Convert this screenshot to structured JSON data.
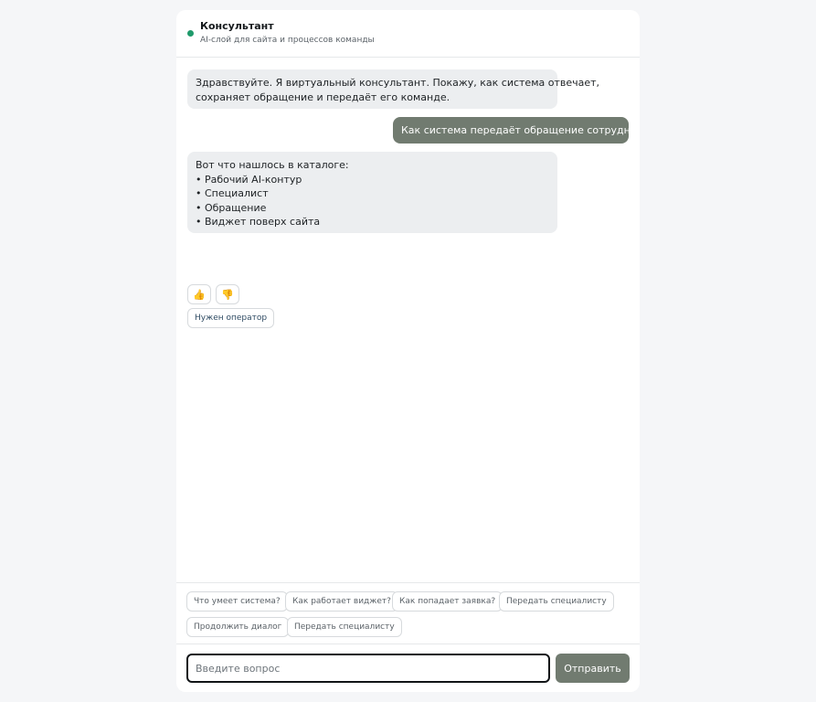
{
  "header": {
    "title": "Консультант",
    "subtitle": "AI-слой для сайта и процессов команды",
    "status_color": "#1f9a6b"
  },
  "messages": {
    "bot_greeting": {
      "lines": [
        "Здравствуйте. Я виртуальный консультант. Покажу, как система отвечает,",
        "сохраняет обращение и передаёт его команде."
      ]
    },
    "user_question": "Как система передаёт обращение сотруднику?",
    "bot_catalog": {
      "lines": [
        "Вот что нашлось в каталоге:",
        "• Рабочий AI-контур",
        "• Специалист",
        "• Обращение",
        "• Виджет поверх сайта"
      ]
    },
    "rating": {
      "up_icon": "👍",
      "down_icon": "👎"
    },
    "operator_label": "Нужен оператор"
  },
  "suggestions": [
    "Что умеет система?",
    "Как работает виджет?",
    "Как попадает заявка?",
    "Передать специалисту",
    "Продолжить диалог",
    "Передать специалисту"
  ],
  "composer": {
    "placeholder": "Введите вопрос",
    "value": "",
    "send_label": "Отправить"
  },
  "colors": {
    "accent": "#717b70",
    "bot_bubble": "#eceef0",
    "page_bg": "#f5f6f8"
  }
}
